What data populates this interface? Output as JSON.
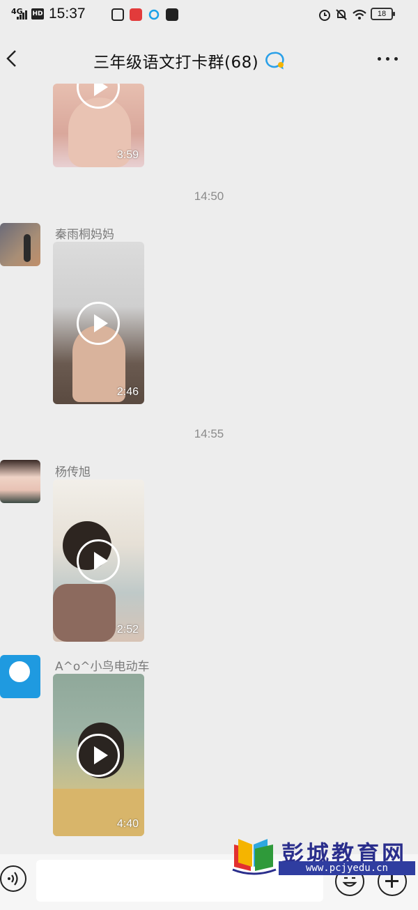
{
  "status_bar": {
    "network": "4G",
    "hd": "HD",
    "time": "15:37",
    "battery": "18",
    "icons": [
      "signal-icon",
      "hd-icon",
      "app-notify-icon",
      "heart-app-icon",
      "chat-app-icon",
      "mail-app-icon",
      "alarm-icon",
      "mute-icon",
      "wifi-icon",
      "battery-icon"
    ]
  },
  "nav": {
    "title": "三年级语文打卡群(68)",
    "back_icon": "chevron-left-icon",
    "more_icon": "more-dots-icon"
  },
  "messages": [
    {
      "type": "video",
      "duration": "3:59",
      "sender": ""
    },
    {
      "type": "time",
      "text": "14:50"
    },
    {
      "type": "video",
      "sender": "秦雨桐妈妈",
      "duration": "2:46"
    },
    {
      "type": "time",
      "text": "14:55"
    },
    {
      "type": "video",
      "sender": "杨传旭",
      "duration": "2:52"
    },
    {
      "type": "video",
      "sender": "A^o^小鸟电动车",
      "duration": "4:40"
    }
  ],
  "input_bar": {
    "placeholder": "",
    "voice_icon": "voice-icon",
    "emoji_icon": "emoji-icon",
    "plus_icon": "plus-icon"
  },
  "watermark": {
    "name": "彭城教育网",
    "url": "www.pcjyedu.cn"
  },
  "colors": {
    "background": "#ededed",
    "time_label": "#8a8a8a",
    "sender_name": "#7a7a7a",
    "watermark_blue": "#2f3da0"
  }
}
